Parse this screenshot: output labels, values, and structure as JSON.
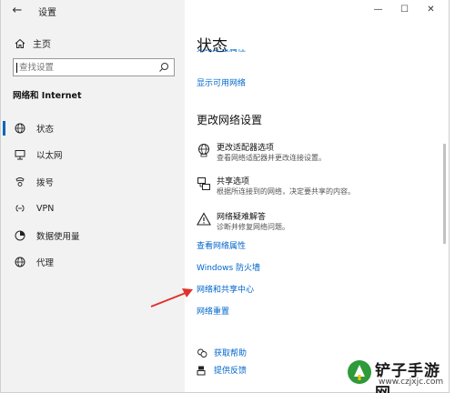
{
  "window": {
    "title": "设置",
    "controls": [
      "—",
      "☐",
      "✕"
    ]
  },
  "sidebar": {
    "home_label": "主页",
    "search_placeholder": "查找设置",
    "section_title": "网络和 Internet",
    "items": [
      {
        "label": "状态",
        "icon": "globe-icon"
      },
      {
        "label": "以太网",
        "icon": "ethernet-icon"
      },
      {
        "label": "拨号",
        "icon": "dialup-icon"
      },
      {
        "label": "VPN",
        "icon": "vpn-icon"
      },
      {
        "label": "数据使用量",
        "icon": "data-usage-icon"
      },
      {
        "label": "代理",
        "icon": "proxy-globe-icon"
      }
    ],
    "active_index": 0
  },
  "main": {
    "title": "状态",
    "cut_link": "更改连接属性",
    "show_networks_link": "显示可用网络",
    "change_settings_title": "更改网络设置",
    "options": [
      {
        "title": "更改适配器选项",
        "desc": "查看网络适配器并更改连接设置。",
        "icon": "adapter-icon"
      },
      {
        "title": "共享选项",
        "desc": "根据所连接到的网络，决定要共享的内容。",
        "icon": "sharing-icon"
      },
      {
        "title": "网络疑难解答",
        "desc": "诊断并修复网络问题。",
        "icon": "warning-icon"
      }
    ],
    "links": {
      "properties": "查看网络属性",
      "firewall": "Windows 防火墙",
      "sharing_center": "网络和共享中心",
      "reset": "网络重置"
    },
    "help": {
      "get_help": "获取帮助",
      "feedback": "提供反馈"
    }
  },
  "watermark": {
    "text": "铲子手游网",
    "url": "www.czjxjc.com"
  },
  "colors": {
    "accent": "#0067b8",
    "link": "#0066cc",
    "arrow": "#e0322c",
    "sidebar_bg": "#f2f2f2"
  }
}
